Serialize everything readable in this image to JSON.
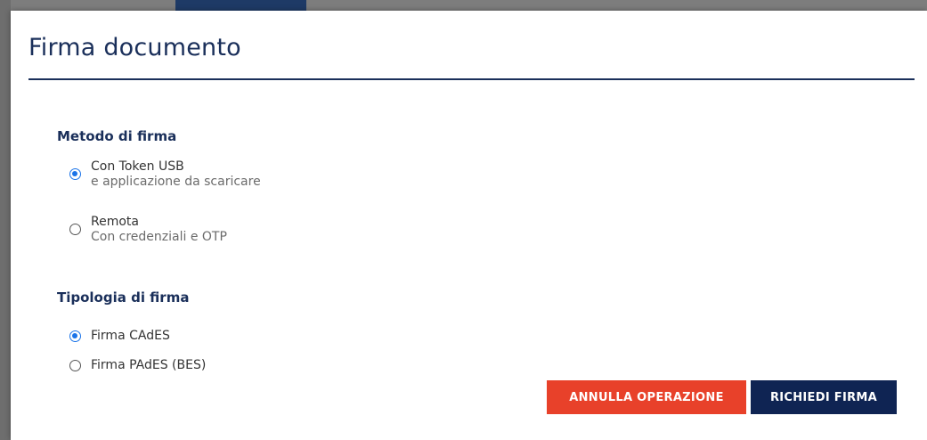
{
  "dialog": {
    "title": "Firma documento"
  },
  "signature_method": {
    "heading": "Metodo di firma",
    "options": [
      {
        "label": "Con Token USB",
        "sublabel": "e applicazione da scaricare",
        "selected": true
      },
      {
        "label": "Remota",
        "sublabel": "Con credenziali e OTP",
        "selected": false
      }
    ]
  },
  "signature_type": {
    "heading": "Tipologia di firma",
    "options": [
      {
        "label": "Firma CAdES",
        "selected": true
      },
      {
        "label": "Firma PAdES (BES)",
        "selected": false
      }
    ]
  },
  "actions": {
    "cancel_label": "ANNULLA OPERAZIONE",
    "submit_label": "RICHIEDI FIRMA"
  },
  "colors": {
    "primary": "#1a2f5a",
    "accent_cancel": "#e8412a",
    "accent_submit": "#0f2453",
    "radio_selected": "#1a73e8"
  }
}
